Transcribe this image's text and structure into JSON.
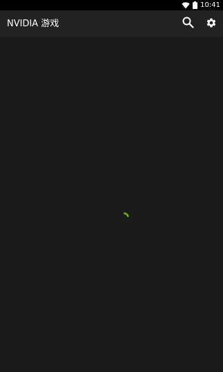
{
  "status_bar": {
    "time": "10:41",
    "wifi_icon": "wifi-icon",
    "battery_icon": "battery-icon"
  },
  "app_bar": {
    "title": "NVIDIA 游戏",
    "search_icon": "search-icon",
    "settings_icon": "gear-icon"
  },
  "content": {
    "state": "loading",
    "spinner_icon": "loading-spinner-icon"
  },
  "colors": {
    "status_bar_bg": "#000000",
    "app_bar_bg": "#222222",
    "content_bg": "#1b1b1b",
    "accent": "#76b900",
    "text": "#ffffff"
  }
}
